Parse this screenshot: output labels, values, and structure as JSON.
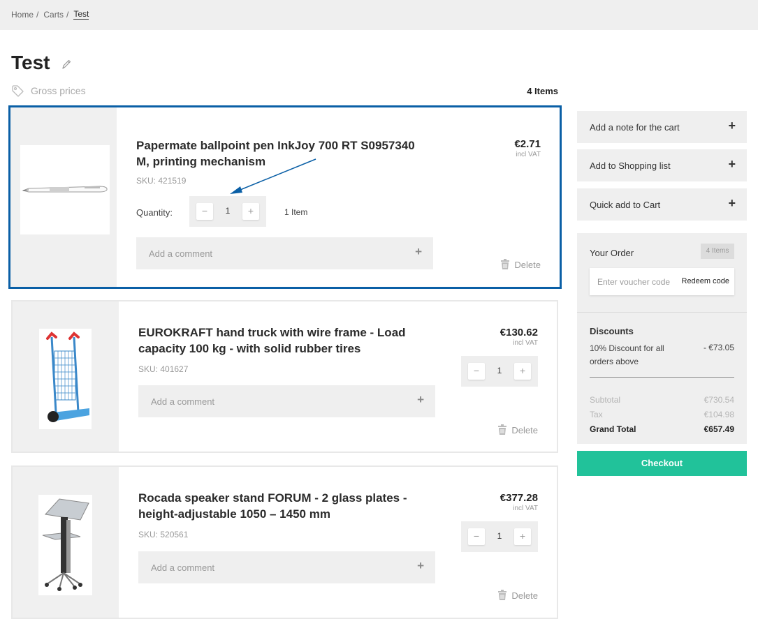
{
  "breadcrumb": {
    "items": [
      "Home",
      "Carts"
    ],
    "current": "Test"
  },
  "page": {
    "title": "Test",
    "price_mode": "Gross prices",
    "items_count": "4 Items"
  },
  "cart_items": [
    {
      "name": "Papermate ballpoint pen InkJoy 700 RT S0957340 M, printing mechanism",
      "sku": "SKU: 421519",
      "price": "€2.71",
      "vat": "incl VAT",
      "quantity_label": "Quantity:",
      "quantity": "1",
      "quantity_text": "1 Item",
      "comment_placeholder": "Add a comment",
      "delete_label": "Delete",
      "image_icon": "pen-image"
    },
    {
      "name": "EUROKRAFT hand truck with wire frame - Load capacity 100 kg - with solid rubber tires",
      "sku": "SKU: 401627",
      "price": "€130.62",
      "vat": "incl VAT",
      "quantity": "1",
      "comment_placeholder": "Add a comment",
      "delete_label": "Delete",
      "image_icon": "hand-truck-image"
    },
    {
      "name": "Rocada speaker stand FORUM - 2 glass plates - height-adjustable 1050 – 1450 mm",
      "sku": "SKU: 520561",
      "price": "€377.28",
      "vat": "incl VAT",
      "quantity": "1",
      "comment_placeholder": "Add a comment",
      "delete_label": "Delete",
      "image_icon": "speaker-stand-image"
    }
  ],
  "sidebar": {
    "actions": [
      {
        "label": "Add a note for the cart"
      },
      {
        "label": "Add to Shopping list"
      },
      {
        "label": "Quick add to Cart"
      }
    ],
    "order": {
      "title": "Your Order",
      "badge": "4 Items",
      "voucher_placeholder": "Enter voucher code",
      "redeem_label": "Redeem code",
      "discounts_title": "Discounts",
      "discount_text": "10% Discount for all orders above",
      "discount_amount": "- €73.05",
      "subtotal_label": "Subtotal",
      "subtotal": "€730.54",
      "tax_label": "Tax",
      "tax": "€104.98",
      "total_label": "Grand Total",
      "total": "€657.49"
    },
    "checkout_label": "Checkout"
  },
  "colors": {
    "selected_border": "#0a5fa6",
    "checkout": "#21c29a",
    "annotation_arrow": "#0a5fa6"
  }
}
